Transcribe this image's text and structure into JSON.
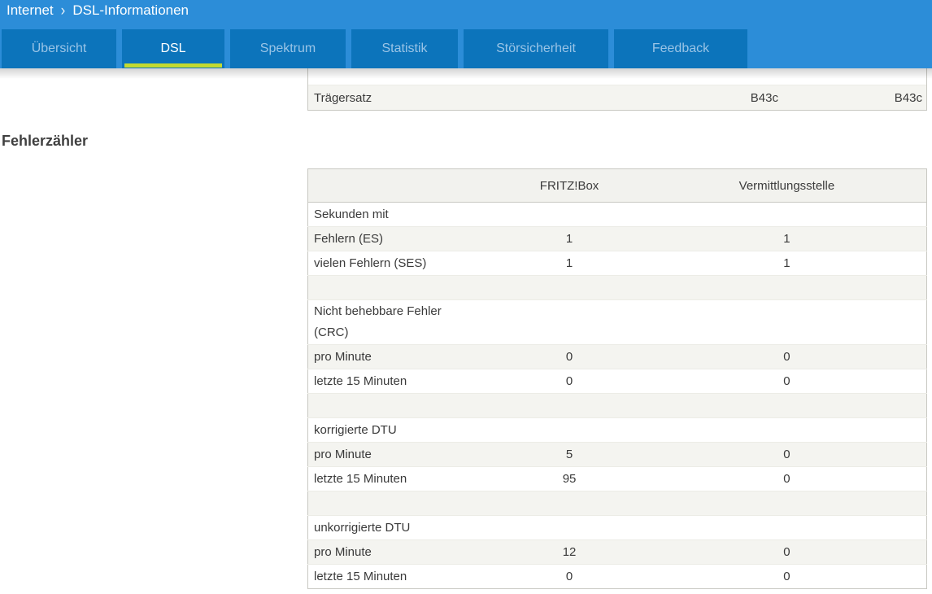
{
  "breadcrumb": {
    "section": "Internet",
    "separator": "›",
    "page": "DSL-Informationen"
  },
  "tabs": [
    {
      "label": "Übersicht",
      "active": false
    },
    {
      "label": "DSL",
      "active": true
    },
    {
      "label": "Spektrum",
      "active": false
    },
    {
      "label": "Statistik",
      "active": false
    },
    {
      "label": "Störsicherheit",
      "active": false
    },
    {
      "label": "Feedback",
      "active": false
    }
  ],
  "carrier_table": {
    "rows": [
      {
        "label": "Trägersatz",
        "fritzbox": "B43c",
        "exchange": "B43c"
      }
    ]
  },
  "section_title": "Fehlerzähler",
  "error_table": {
    "columns": [
      "",
      "FRITZ!Box",
      "Vermittlungsstelle"
    ],
    "rows": [
      {
        "label": "Sekunden mit",
        "fritzbox": "",
        "exchange": ""
      },
      {
        "label": "Fehlern (ES)",
        "fritzbox": "1",
        "exchange": "1"
      },
      {
        "label": "vielen Fehlern (SES)",
        "fritzbox": "1",
        "exchange": "1"
      },
      {
        "label": "",
        "fritzbox": "",
        "exchange": ""
      },
      {
        "label": "Nicht behebbare Fehler (CRC)",
        "fritzbox": "",
        "exchange": ""
      },
      {
        "label": "pro Minute",
        "fritzbox": "0",
        "exchange": "0"
      },
      {
        "label": "letzte 15 Minuten",
        "fritzbox": "0",
        "exchange": "0"
      },
      {
        "label": "",
        "fritzbox": "",
        "exchange": ""
      },
      {
        "label": "korrigierte DTU",
        "fritzbox": "",
        "exchange": ""
      },
      {
        "label": "pro Minute",
        "fritzbox": "5",
        "exchange": "0"
      },
      {
        "label": "letzte 15 Minuten",
        "fritzbox": "95",
        "exchange": "0"
      },
      {
        "label": "",
        "fritzbox": "",
        "exchange": ""
      },
      {
        "label": "unkorrigierte DTU",
        "fritzbox": "",
        "exchange": ""
      },
      {
        "label": "pro Minute",
        "fritzbox": "12",
        "exchange": "0"
      },
      {
        "label": "letzte 15 Minuten",
        "fritzbox": "0",
        "exchange": "0"
      }
    ]
  },
  "colors": {
    "header_blue": "#2C8DD8",
    "tab_blue": "#0C74BB",
    "inactive_tab_text": "#9AC4E6",
    "active_tab_underline": "#C3DA31",
    "row_stripe": "#F4F4F0",
    "table_border": "#C8C8C2",
    "text": "#3A3A3A"
  }
}
